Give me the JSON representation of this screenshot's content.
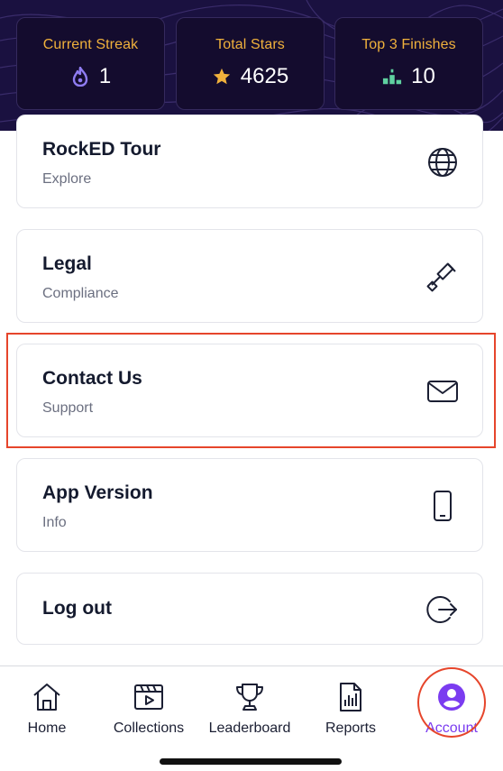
{
  "stats": [
    {
      "label": "Current Streak",
      "value": "1",
      "icon": "flame-icon"
    },
    {
      "label": "Total Stars",
      "value": "4625",
      "icon": "star-icon"
    },
    {
      "label": "Top 3 Finishes",
      "value": "10",
      "icon": "podium-icon"
    }
  ],
  "items": [
    {
      "title": "RockED Tour",
      "subtitle": "Explore",
      "icon": "globe-icon"
    },
    {
      "title": "Legal",
      "subtitle": "Compliance",
      "icon": "gavel-icon"
    },
    {
      "title": "Contact Us",
      "subtitle": "Support",
      "icon": "envelope-icon"
    },
    {
      "title": "App Version",
      "subtitle": "Info",
      "icon": "phone-icon"
    },
    {
      "title": "Log out",
      "subtitle": "",
      "icon": "logout-icon"
    }
  ],
  "nav": [
    {
      "label": "Home",
      "icon": "home-icon"
    },
    {
      "label": "Collections",
      "icon": "clapperboard-icon"
    },
    {
      "label": "Leaderboard",
      "icon": "trophy-icon"
    },
    {
      "label": "Reports",
      "icon": "report-icon"
    },
    {
      "label": "Account",
      "icon": "account-icon",
      "active": true
    }
  ],
  "colors": {
    "header_bg": "#1a1140",
    "stat_label": "#f0b13c",
    "accent": "#7b3cf0",
    "highlight": "#e6452b",
    "flame": "#8f7cf2",
    "star": "#f0b13c",
    "podium": "#5fd1a0"
  }
}
